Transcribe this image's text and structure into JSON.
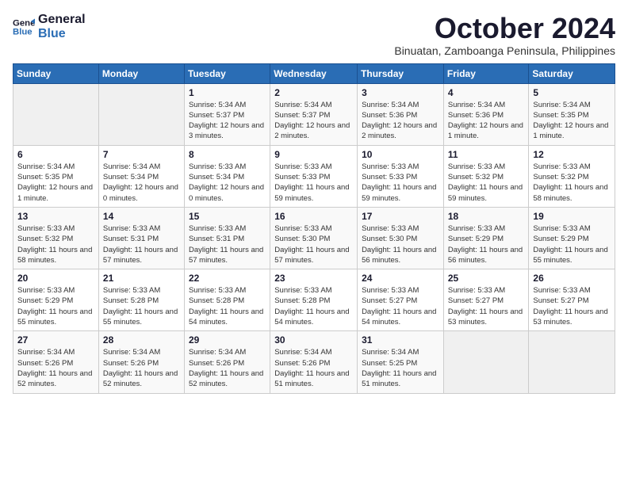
{
  "logo": {
    "line1": "General",
    "line2": "Blue"
  },
  "title": "October 2024",
  "subtitle": "Binuatan, Zamboanga Peninsula, Philippines",
  "days_of_week": [
    "Sunday",
    "Monday",
    "Tuesday",
    "Wednesday",
    "Thursday",
    "Friday",
    "Saturday"
  ],
  "weeks": [
    [
      {
        "day": "",
        "info": ""
      },
      {
        "day": "",
        "info": ""
      },
      {
        "day": "1",
        "info": "Sunrise: 5:34 AM\nSunset: 5:37 PM\nDaylight: 12 hours and 3 minutes."
      },
      {
        "day": "2",
        "info": "Sunrise: 5:34 AM\nSunset: 5:37 PM\nDaylight: 12 hours and 2 minutes."
      },
      {
        "day": "3",
        "info": "Sunrise: 5:34 AM\nSunset: 5:36 PM\nDaylight: 12 hours and 2 minutes."
      },
      {
        "day": "4",
        "info": "Sunrise: 5:34 AM\nSunset: 5:36 PM\nDaylight: 12 hours and 1 minute."
      },
      {
        "day": "5",
        "info": "Sunrise: 5:34 AM\nSunset: 5:35 PM\nDaylight: 12 hours and 1 minute."
      }
    ],
    [
      {
        "day": "6",
        "info": "Sunrise: 5:34 AM\nSunset: 5:35 PM\nDaylight: 12 hours and 1 minute."
      },
      {
        "day": "7",
        "info": "Sunrise: 5:34 AM\nSunset: 5:34 PM\nDaylight: 12 hours and 0 minutes."
      },
      {
        "day": "8",
        "info": "Sunrise: 5:33 AM\nSunset: 5:34 PM\nDaylight: 12 hours and 0 minutes."
      },
      {
        "day": "9",
        "info": "Sunrise: 5:33 AM\nSunset: 5:33 PM\nDaylight: 11 hours and 59 minutes."
      },
      {
        "day": "10",
        "info": "Sunrise: 5:33 AM\nSunset: 5:33 PM\nDaylight: 11 hours and 59 minutes."
      },
      {
        "day": "11",
        "info": "Sunrise: 5:33 AM\nSunset: 5:32 PM\nDaylight: 11 hours and 59 minutes."
      },
      {
        "day": "12",
        "info": "Sunrise: 5:33 AM\nSunset: 5:32 PM\nDaylight: 11 hours and 58 minutes."
      }
    ],
    [
      {
        "day": "13",
        "info": "Sunrise: 5:33 AM\nSunset: 5:32 PM\nDaylight: 11 hours and 58 minutes."
      },
      {
        "day": "14",
        "info": "Sunrise: 5:33 AM\nSunset: 5:31 PM\nDaylight: 11 hours and 57 minutes."
      },
      {
        "day": "15",
        "info": "Sunrise: 5:33 AM\nSunset: 5:31 PM\nDaylight: 11 hours and 57 minutes."
      },
      {
        "day": "16",
        "info": "Sunrise: 5:33 AM\nSunset: 5:30 PM\nDaylight: 11 hours and 57 minutes."
      },
      {
        "day": "17",
        "info": "Sunrise: 5:33 AM\nSunset: 5:30 PM\nDaylight: 11 hours and 56 minutes."
      },
      {
        "day": "18",
        "info": "Sunrise: 5:33 AM\nSunset: 5:29 PM\nDaylight: 11 hours and 56 minutes."
      },
      {
        "day": "19",
        "info": "Sunrise: 5:33 AM\nSunset: 5:29 PM\nDaylight: 11 hours and 55 minutes."
      }
    ],
    [
      {
        "day": "20",
        "info": "Sunrise: 5:33 AM\nSunset: 5:29 PM\nDaylight: 11 hours and 55 minutes."
      },
      {
        "day": "21",
        "info": "Sunrise: 5:33 AM\nSunset: 5:28 PM\nDaylight: 11 hours and 55 minutes."
      },
      {
        "day": "22",
        "info": "Sunrise: 5:33 AM\nSunset: 5:28 PM\nDaylight: 11 hours and 54 minutes."
      },
      {
        "day": "23",
        "info": "Sunrise: 5:33 AM\nSunset: 5:28 PM\nDaylight: 11 hours and 54 minutes."
      },
      {
        "day": "24",
        "info": "Sunrise: 5:33 AM\nSunset: 5:27 PM\nDaylight: 11 hours and 54 minutes."
      },
      {
        "day": "25",
        "info": "Sunrise: 5:33 AM\nSunset: 5:27 PM\nDaylight: 11 hours and 53 minutes."
      },
      {
        "day": "26",
        "info": "Sunrise: 5:33 AM\nSunset: 5:27 PM\nDaylight: 11 hours and 53 minutes."
      }
    ],
    [
      {
        "day": "27",
        "info": "Sunrise: 5:34 AM\nSunset: 5:26 PM\nDaylight: 11 hours and 52 minutes."
      },
      {
        "day": "28",
        "info": "Sunrise: 5:34 AM\nSunset: 5:26 PM\nDaylight: 11 hours and 52 minutes."
      },
      {
        "day": "29",
        "info": "Sunrise: 5:34 AM\nSunset: 5:26 PM\nDaylight: 11 hours and 52 minutes."
      },
      {
        "day": "30",
        "info": "Sunrise: 5:34 AM\nSunset: 5:26 PM\nDaylight: 11 hours and 51 minutes."
      },
      {
        "day": "31",
        "info": "Sunrise: 5:34 AM\nSunset: 5:25 PM\nDaylight: 11 hours and 51 minutes."
      },
      {
        "day": "",
        "info": ""
      },
      {
        "day": "",
        "info": ""
      }
    ]
  ]
}
